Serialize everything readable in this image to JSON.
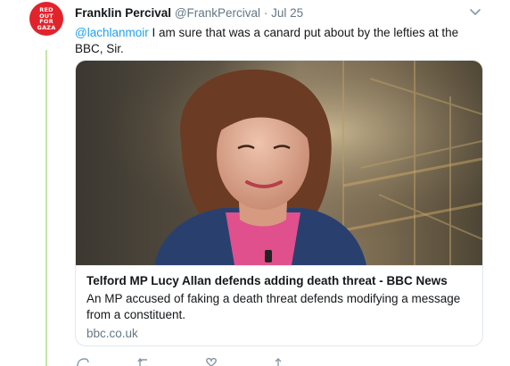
{
  "tweet": {
    "avatar_text": [
      "RED",
      "OUT",
      "FOR",
      "GAZA"
    ],
    "display_name": "Franklin Percival",
    "handle": "@FrankPercival",
    "separator": "·",
    "date": "Jul 25",
    "mention": "@lachlanmoir",
    "text": " I am sure that was a canard put about by the lefties at the BBC, Sir."
  },
  "card": {
    "title": "Telford MP Lucy Allan defends adding death threat - BBC News",
    "description": "An MP accused of faking a death threat defends modifying a message from a constituent.",
    "domain": "bbc.co.uk"
  },
  "actions": {
    "icons": [
      "reply-icon",
      "retweet-icon",
      "like-icon",
      "share-icon"
    ]
  },
  "colors": {
    "accent": "#1da1f2",
    "thread_line": "#c4e6a5",
    "avatar": "#e3232c",
    "muted": "#657786"
  }
}
